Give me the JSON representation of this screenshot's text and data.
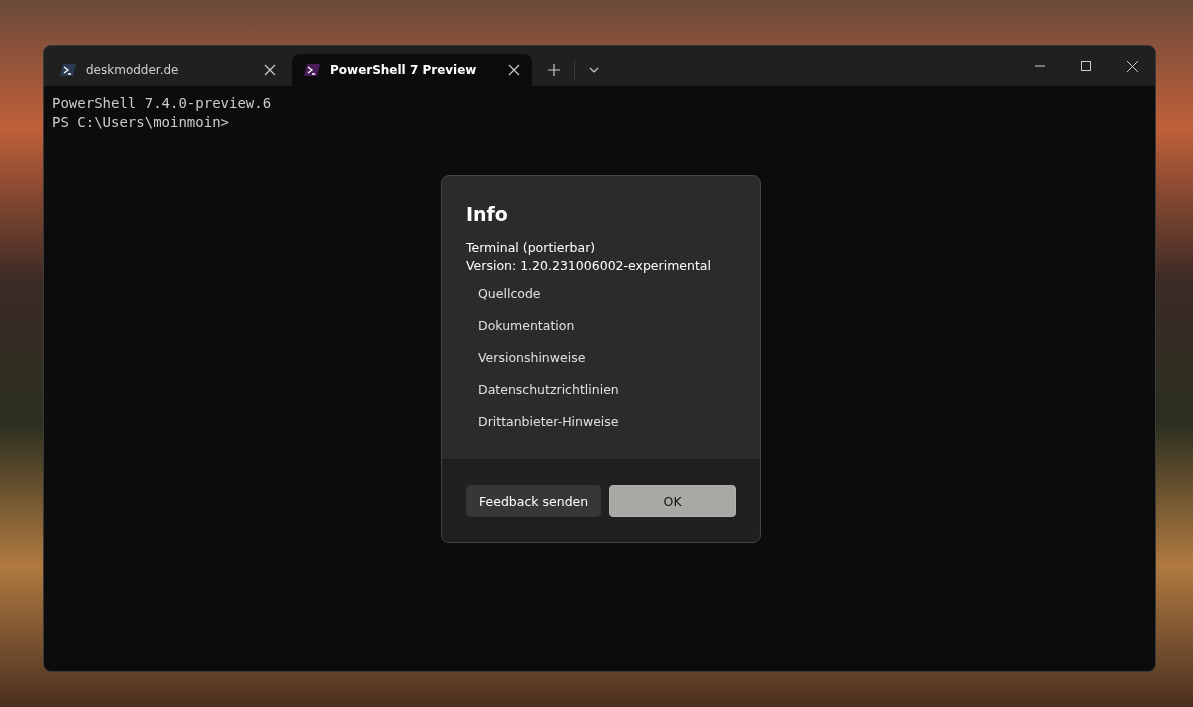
{
  "tabs": [
    {
      "label": "deskmodder.de",
      "selected": false
    },
    {
      "label": "PowerShell 7 Preview",
      "selected": true
    }
  ],
  "terminal": {
    "lines": [
      "PowerShell 7.4.0-preview.6",
      "PS C:\\Users\\moinmoin>"
    ]
  },
  "dialog": {
    "title": "Info",
    "lines": [
      "Terminal (portierbar)",
      "Version: 1.20.231006002-experimental"
    ],
    "links": [
      "Quellcode",
      "Dokumentation",
      "Versionshinweise",
      "Datenschutzrichtlinien",
      "Drittanbieter-Hinweise"
    ],
    "buttons": [
      {
        "label": "Feedback senden",
        "kind": "secondary"
      },
      {
        "label": "OK",
        "kind": "primary"
      }
    ]
  }
}
